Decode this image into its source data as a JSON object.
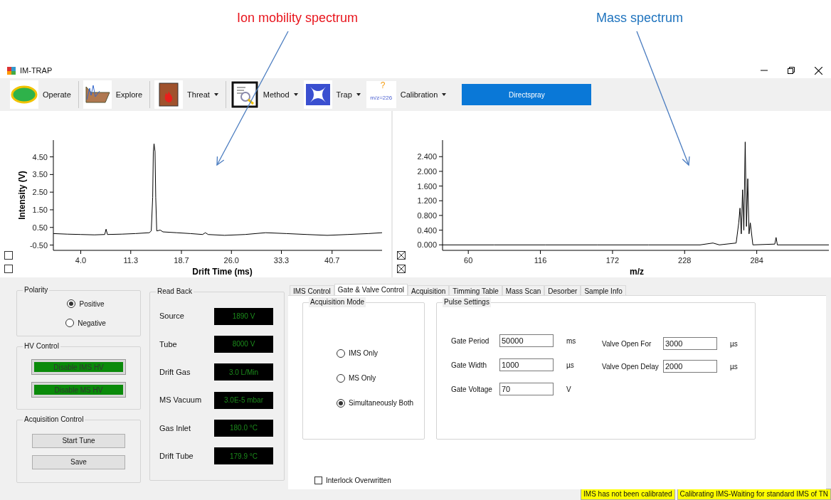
{
  "annotations": [
    {
      "text": "Ion mobility  spectrum",
      "color": "#e8141c"
    },
    {
      "text": "Mass spectrum",
      "color": "#1e73be"
    }
  ],
  "window": {
    "title": "IM-TRAP"
  },
  "toolbar": {
    "items": [
      {
        "kind": "button",
        "label": "Operate"
      },
      {
        "kind": "button",
        "label": "Explore"
      },
      {
        "kind": "dropdown",
        "label": "Threat"
      },
      {
        "kind": "dropdown",
        "label": "Method"
      },
      {
        "kind": "dropdown",
        "label": "Trap"
      },
      {
        "kind": "dropdown",
        "label": "Calibration"
      }
    ],
    "calibration_badge": {
      "prefix": "m/z=",
      "value": "226",
      "mark": "?"
    },
    "primary_button": "Directspray"
  },
  "ims_chart": {
    "toggles": [
      {
        "checked": false
      },
      {
        "checked": false
      }
    ],
    "chart_data": {
      "type": "line",
      "xlabel": "Drift Time (ms)",
      "ylabel": "Intensity (V)",
      "xlim": [
        0,
        48
      ],
      "ylim": [
        -0.8,
        5.45
      ],
      "xticks": [
        {
          "value": 4,
          "label": "4.0"
        },
        {
          "value": 11.3,
          "label": "11.3"
        },
        {
          "value": 18.7,
          "label": "18.7"
        },
        {
          "value": 26,
          "label": "26.0"
        },
        {
          "value": 33.3,
          "label": "33.3"
        },
        {
          "value": 40.7,
          "label": "40.7"
        }
      ],
      "yticks": [
        {
          "value": -0.5,
          "label": "-0.50"
        },
        {
          "value": 0.5,
          "label": "0.50"
        },
        {
          "value": 1.5,
          "label": "1.50"
        },
        {
          "value": 2.5,
          "label": "2.50"
        },
        {
          "value": 3.5,
          "label": "3.50"
        },
        {
          "value": 4.5,
          "label": "4.50"
        }
      ],
      "x": [
        0,
        2,
        4,
        6,
        7.5,
        7.7,
        7.9,
        10,
        12,
        14,
        14.3,
        14.5,
        14.6,
        14.7,
        14.85,
        14.95,
        15.1,
        15.6,
        16,
        18,
        20,
        21.8,
        22.2,
        22.6,
        25,
        28,
        31,
        34,
        37,
        40,
        43,
        46,
        48
      ],
      "series": [
        {
          "color": "#000000",
          "values": [
            0.15,
            0.12,
            0.1,
            0.08,
            0.1,
            0.4,
            0.1,
            0.12,
            0.15,
            0.2,
            0.3,
            2.2,
            4.8,
            5.25,
            4.8,
            2.2,
            0.3,
            0.35,
            0.25,
            0.2,
            0.15,
            0.1,
            0.2,
            0.1,
            0.05,
            0.1,
            0.2,
            0.15,
            0.1,
            0.05,
            0.1,
            0.15,
            0.2
          ]
        }
      ]
    }
  },
  "ms_chart": {
    "toggles": [
      {
        "checked": true
      },
      {
        "checked": true
      }
    ],
    "chart_data": {
      "type": "line",
      "xlabel": "m/z",
      "xlim": [
        40,
        340
      ],
      "ylim": [
        -0.15,
        2.85
      ],
      "xticks": [
        60,
        116,
        172,
        228,
        284
      ],
      "yticks": [
        {
          "value": 0,
          "label": "0.000"
        },
        {
          "value": 0.4,
          "label": "0.400"
        },
        {
          "value": 0.8,
          "label": "0.800"
        },
        {
          "value": 1.2,
          "label": "1.200"
        },
        {
          "value": 1.6,
          "label": "1.600"
        },
        {
          "value": 2,
          "label": "2.000"
        },
        {
          "value": 2.4,
          "label": "2.400"
        }
      ],
      "x": [
        40,
        80,
        120,
        160,
        200,
        240,
        250,
        255,
        268,
        270,
        271,
        272,
        273,
        274,
        275,
        276,
        277,
        278,
        279,
        281,
        298,
        299,
        300,
        340
      ],
      "series": [
        {
          "color": "#000000",
          "values": [
            0,
            0,
            0,
            0,
            0,
            0,
            0.05,
            0,
            0.05,
            0.6,
            1.0,
            0.3,
            1.5,
            0.4,
            2.8,
            0.5,
            1.8,
            0.3,
            0.6,
            0,
            0.02,
            0.2,
            0,
            0
          ]
        }
      ]
    }
  },
  "polarity": {
    "title": "Polarity",
    "options": [
      {
        "label": "Positive",
        "selected": true
      },
      {
        "label": "Negative",
        "selected": false
      }
    ]
  },
  "hv_control": {
    "title": "HV Control",
    "buttons": [
      {
        "label": "Disable IMS HV",
        "on": true
      },
      {
        "label": "Disable MS HV",
        "on": true
      }
    ]
  },
  "acquisition_control": {
    "title": "Acquisition Control",
    "buttons": [
      "Start Tune",
      "Save"
    ]
  },
  "read_back": {
    "title": "Read Back",
    "rows": [
      {
        "label": "Source",
        "value": "1890 V"
      },
      {
        "label": "Tube",
        "value": "8000 V"
      },
      {
        "label": "Drift Gas",
        "value": "3.0 L/Min"
      },
      {
        "label": "MS Vacuum",
        "value": "3.0E-5 mbar"
      },
      {
        "label": "Gas Inlet",
        "value": "180.0 °C"
      },
      {
        "label": "Drift Tube",
        "value": "179.9 °C"
      }
    ]
  },
  "tabs": [
    {
      "label": "IMS Control",
      "selected": false
    },
    {
      "label": "Gate & Valve Control",
      "selected": true
    },
    {
      "label": "Acquisition",
      "selected": false
    },
    {
      "label": "Timming Table",
      "selected": false
    },
    {
      "label": "Mass Scan",
      "selected": false
    },
    {
      "label": "Desorber",
      "selected": false
    },
    {
      "label": "Sample Info",
      "selected": false
    }
  ],
  "acquisition_mode": {
    "title": "Acquisition Mode",
    "options": [
      {
        "label": "IMS Only",
        "selected": false
      },
      {
        "label": "MS Only",
        "selected": false
      },
      {
        "label": "Simultaneously Both",
        "selected": true
      }
    ]
  },
  "pulse_settings": {
    "title": "Pulse Settings",
    "groups": [
      {
        "fields": [
          {
            "label": "Gate Period",
            "value": "50000",
            "unit": "ms"
          },
          {
            "label": "Gate Width",
            "value": "1000",
            "unit": "µs"
          },
          {
            "label": "Gate Voltage",
            "value": "70",
            "unit": "V"
          }
        ]
      },
      {
        "fields": [
          {
            "label": "Valve Open For",
            "value": "3000",
            "unit": "µs"
          },
          {
            "label": "Valve Open Delay",
            "value": "2000",
            "unit": "µs"
          }
        ]
      }
    ]
  },
  "interlock": {
    "label": "Interlock Overwritten",
    "checked": false
  },
  "status_bar": [
    "IMS has not been calibrated",
    "Calibrating IMS-Waiting for standard IMS of TN"
  ]
}
